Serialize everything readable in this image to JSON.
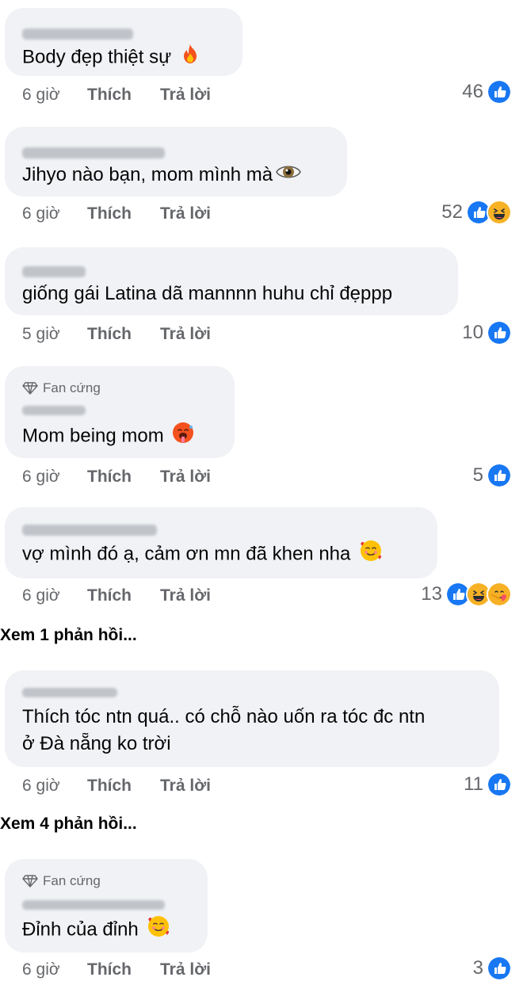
{
  "labels": {
    "like": "Thích",
    "reply": "Trả lời"
  },
  "comments": [
    {
      "text": "Body đẹp thiệt sự",
      "emoji": "fire-icon",
      "time": "6 giờ",
      "count": "46",
      "reactions": [
        "like"
      ]
    },
    {
      "text": "Jihyo nào bạn, mom mình mà",
      "emoji": "eye-icon",
      "time": "6 giờ",
      "count": "52",
      "reactions": [
        "like",
        "haha"
      ]
    },
    {
      "text": "giống gái Latina dã mannnn huhu chỉ đẹppp",
      "time": "5 giờ",
      "count": "10",
      "reactions": [
        "like"
      ]
    },
    {
      "badge": "Fan cứng",
      "text": "Mom being mom",
      "emoji": "hot-face-icon",
      "time": "6 giờ",
      "count": "5",
      "reactions": [
        "like"
      ]
    },
    {
      "text": "vợ mình đó ạ, cảm ơn mn đã khen nha",
      "emoji": "smiling-face-with-hearts-icon",
      "time": "6 giờ",
      "count": "13",
      "reactions": [
        "like",
        "haha",
        "care"
      ]
    },
    {
      "text_lines": [
        "Thích tóc ntn quá.. có chỗ nào uốn ra tóc đc ntn",
        "ở Đà nẵng ko trời"
      ],
      "time": "6 giờ",
      "count": "11",
      "reactions": [
        "like"
      ]
    },
    {
      "badge": "Fan cứng",
      "text": "Đỉnh của đỉnh",
      "emoji": "smiling-face-with-hearts-icon",
      "time": "6 giờ",
      "count": "3",
      "reactions": [
        "like"
      ]
    }
  ],
  "view_replies": [
    "Xem 1 phản hồi...",
    "Xem 4 phản hồi..."
  ],
  "colors": {
    "like_blue": "#1877f2",
    "bubble_bg": "#f0f2f5",
    "meta_gray": "#65676b",
    "haha_yellow": "#f7b125"
  }
}
